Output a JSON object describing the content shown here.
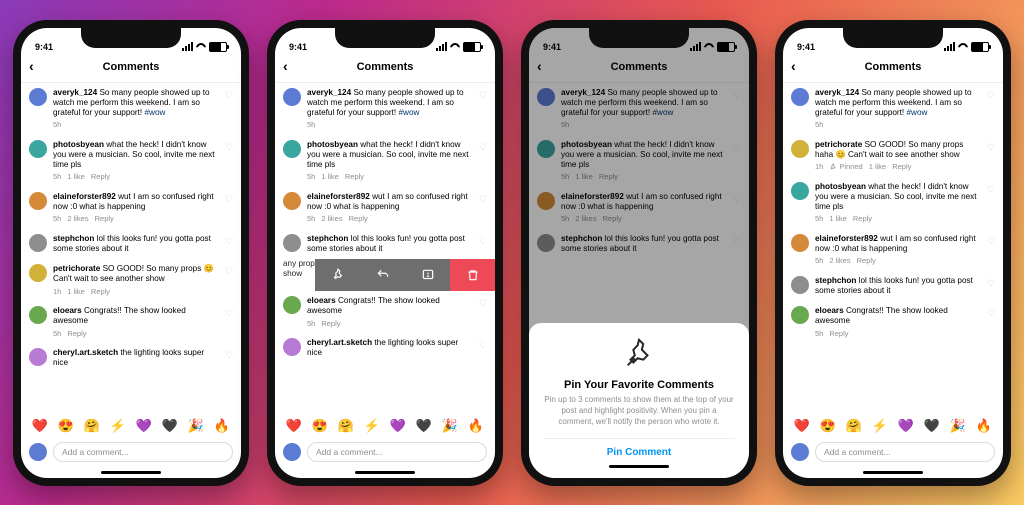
{
  "status": {
    "time": "9:41"
  },
  "header": {
    "title": "Comments"
  },
  "compose": {
    "placeholder": "Add a comment..."
  },
  "emoji_bar": [
    "❤️",
    "😍",
    "🤗",
    "⚡",
    "💜",
    "🖤",
    "🎉",
    "🔥"
  ],
  "avatar_colors": [
    "#5b7bd5",
    "#3aa6a0",
    "#d58a3a",
    "#8e8e8e",
    "#d1b13a",
    "#6aa84f",
    "#b77bd5",
    "#5b7bd5"
  ],
  "comments_base": [
    {
      "user": "averyk_124",
      "text": "So many people showed up to watch me perform this weekend. I am so grateful for your support! ",
      "tag": "#wow",
      "time": "5h",
      "likes": "",
      "reply": ""
    },
    {
      "user": "photosbyean",
      "text": "what the heck! I didn't know you were a musician. So cool, invite me next time pls",
      "time": "5h",
      "likes": "1 like",
      "reply": "Reply"
    },
    {
      "user": "elaineforster892",
      "text": "wut I am so confused right now :0 what is happening",
      "time": "5h",
      "likes": "2 likes",
      "reply": "Reply"
    },
    {
      "user": "stephchon",
      "text": "lol this looks fun! you gotta post some stories about it",
      "time": "",
      "likes": "",
      "reply": ""
    },
    {
      "user": "petrichorate",
      "text": "SO GOOD! So many props 😊 Can't wait to see another show",
      "time": "1h",
      "likes": "1 like",
      "reply": "Reply"
    },
    {
      "user": "eloears",
      "text": "Congrats!! The show looked awesome",
      "time": "5h",
      "likes": "",
      "reply": "Reply"
    },
    {
      "user": "cheryl.art.sketch",
      "text": "the lighting looks super nice",
      "time": "",
      "likes": "",
      "reply": ""
    }
  ],
  "swiped_fragment": {
    "line1": "any props",
    "line2": "show"
  },
  "sheet": {
    "title": "Pin Your Favorite Comments",
    "body": "Pin up to 3 comments to show them at the top of your post and highlight positivity. When you pin a comment, we'll notify the person who wrote it.",
    "cta": "Pin Comment"
  },
  "pinned_comment": {
    "user": "petrichorate",
    "text": "SO GOOD! So many props haha 😊 Can't wait to see another show",
    "time": "1h",
    "pinned_label": "Pinned",
    "likes": "1 like",
    "reply": "Reply"
  }
}
